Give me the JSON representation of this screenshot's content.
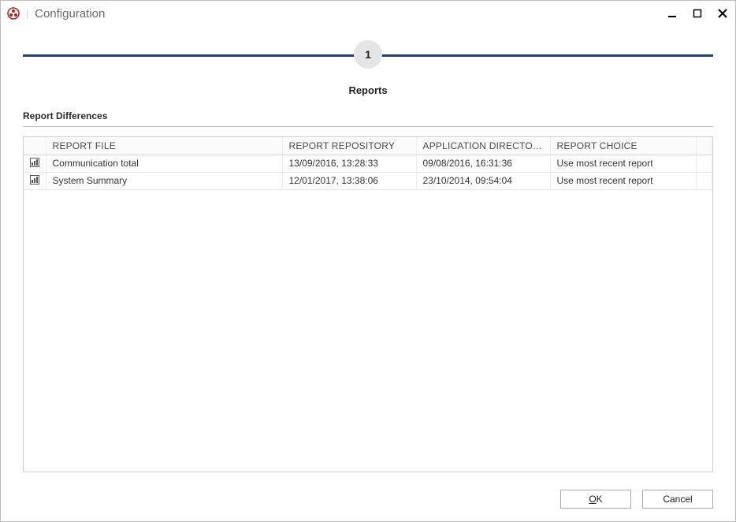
{
  "window": {
    "title": "Configuration"
  },
  "step": {
    "number": "1",
    "title": "Reports"
  },
  "section": {
    "header": "Report Differences"
  },
  "table": {
    "columns": {
      "file": "REPORT FILE",
      "repo": "REPORT REPOSITORY",
      "appdir": "APPLICATION DIRECTORY",
      "choice": "REPORT CHOICE"
    },
    "rows": [
      {
        "file": "Communication total",
        "repo": "13/09/2016, 13:28:33",
        "appdir": "09/08/2016, 16:31:36",
        "choice": "Use most recent report"
      },
      {
        "file": "System Summary",
        "repo": "12/01/2017, 13:38:06",
        "appdir": "23/10/2014, 09:54:04",
        "choice": "Use most recent report"
      }
    ]
  },
  "buttons": {
    "ok_prefix": "O",
    "ok_suffix": "K",
    "cancel": "Cancel"
  }
}
